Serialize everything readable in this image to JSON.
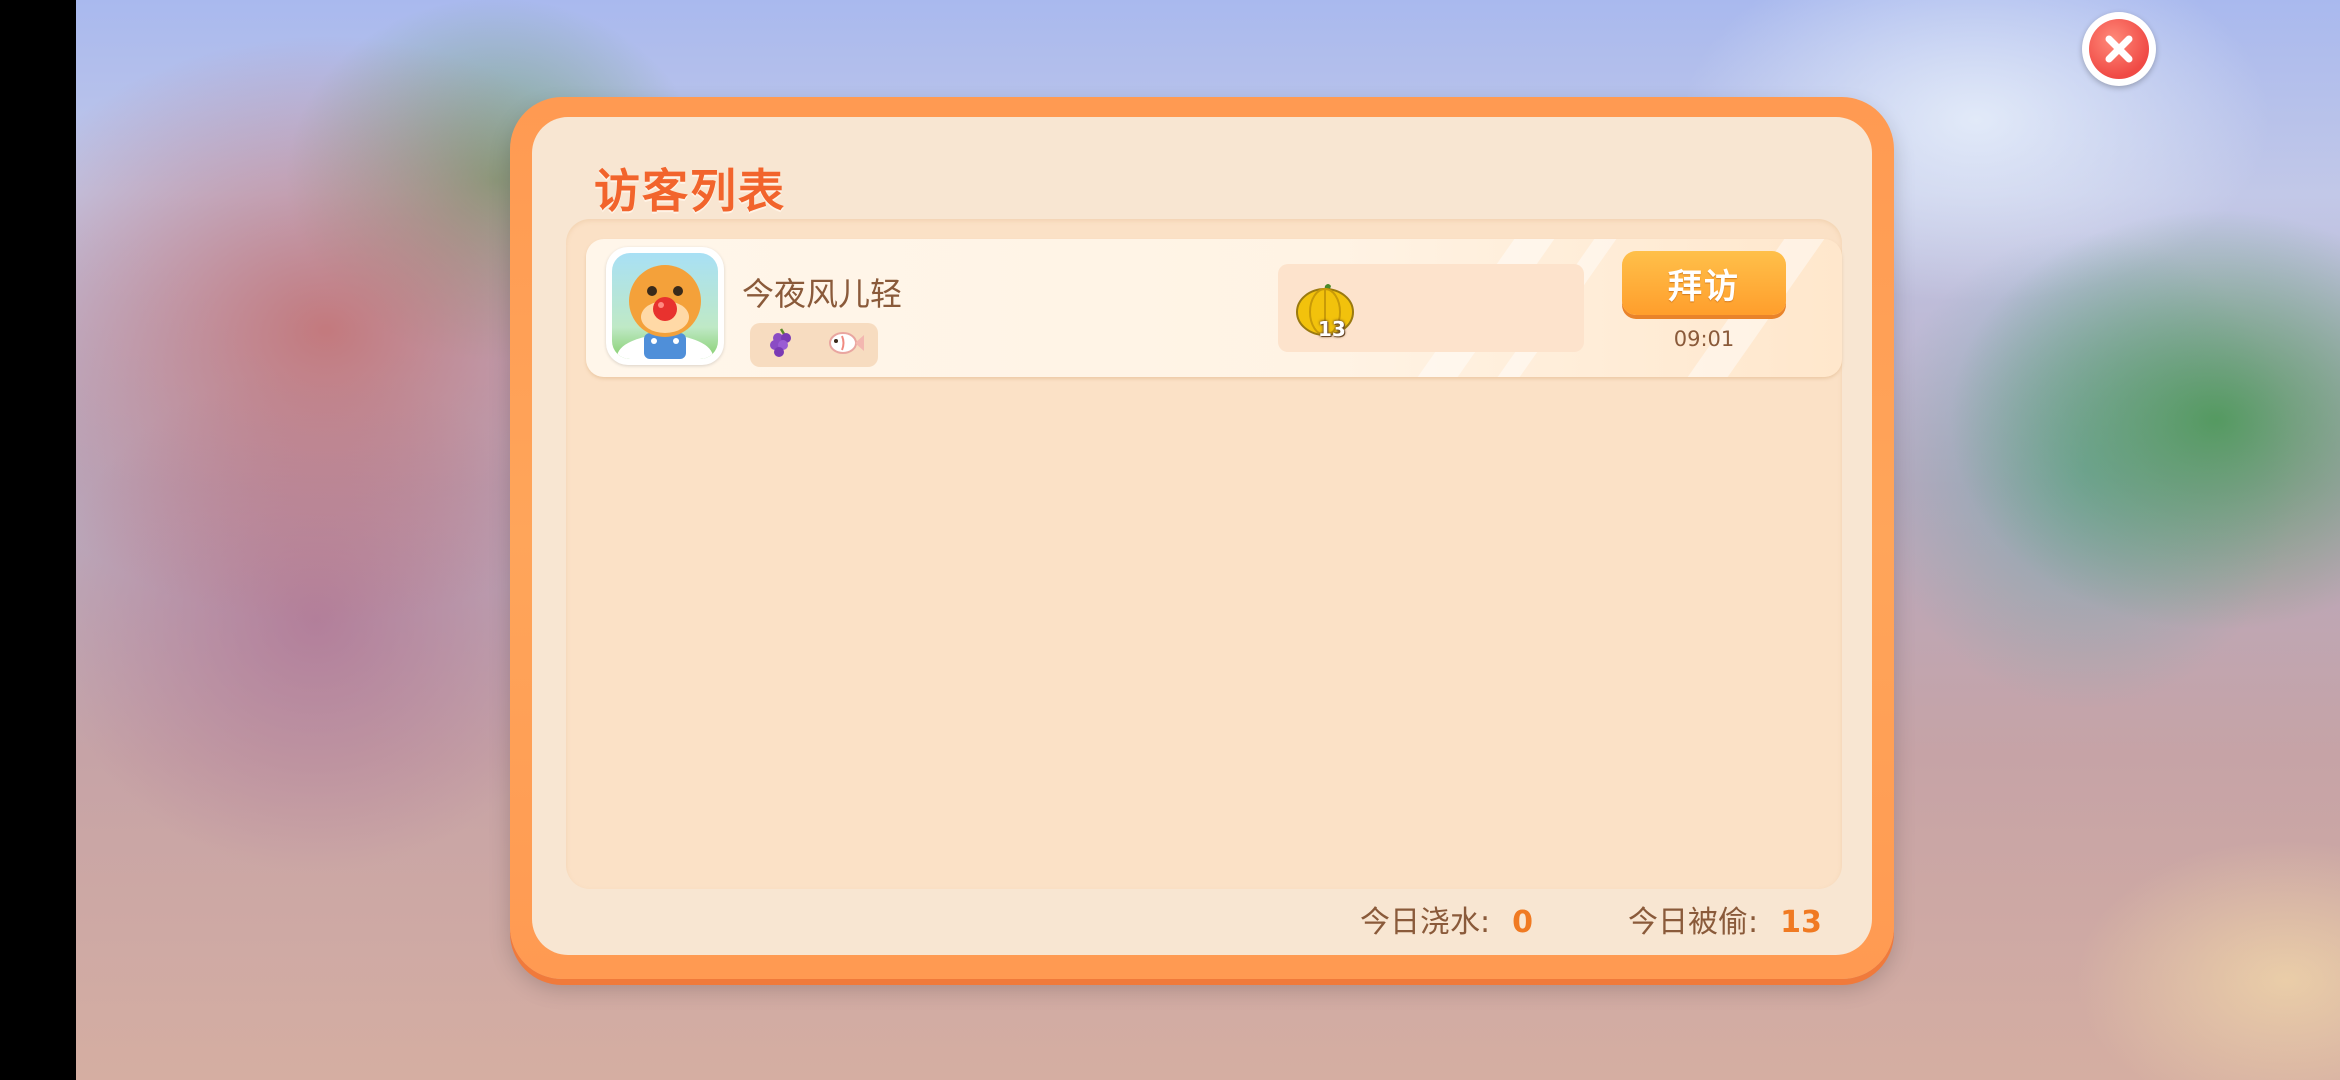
{
  "panel": {
    "title": "访客列表"
  },
  "visitors": [
    {
      "name": "今夜风儿轻",
      "tags": [
        "grape-icon",
        "fish-icon"
      ],
      "loot": {
        "icon": "pumpkin-icon",
        "count": "13"
      },
      "visit_label": "拜访",
      "time": "09:01"
    }
  ],
  "footer": {
    "watered_label": "今日浇水:",
    "watered_value": "0",
    "stolen_label": "今日被偷:",
    "stolen_value": "13"
  },
  "icons": {
    "close": "close-icon"
  },
  "colors": {
    "accent_orange": "#ff9a52",
    "title_orange": "#f2642c",
    "button_orange": "#ffac38",
    "text_brown": "#8a5a3a",
    "value_orange": "#f07a22"
  }
}
